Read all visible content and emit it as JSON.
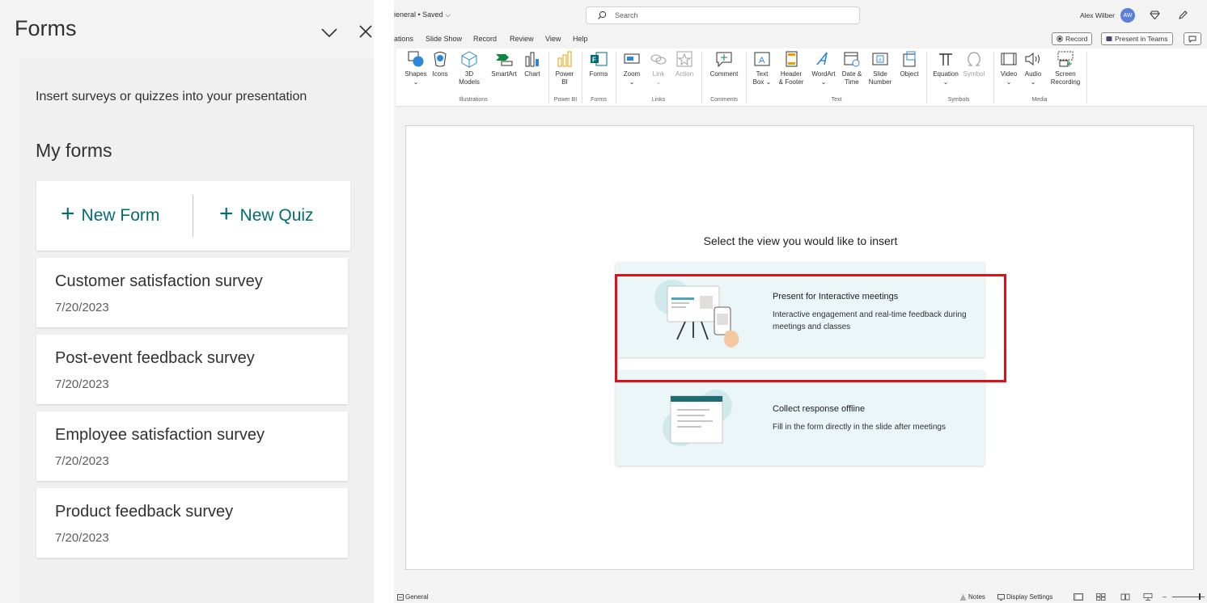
{
  "forms_pane": {
    "title": "Forms",
    "description": "Insert surveys or quizzes into your presentation",
    "section_title": "My forms",
    "new_form_label": "New Form",
    "new_quiz_label": "New Quiz",
    "forms": [
      {
        "name": "Customer satisfaction survey",
        "date": "7/20/2023"
      },
      {
        "name": "Post-event feedback survey",
        "date": "7/20/2023"
      },
      {
        "name": "Employee satisfaction survey",
        "date": "7/20/2023"
      },
      {
        "name": "Product feedback survey",
        "date": "7/20/2023"
      }
    ]
  },
  "titlebar": {
    "doc_title": "ieneral • Saved",
    "search_placeholder": "Search",
    "user_name": "Alex Wilber",
    "user_initials": "AW"
  },
  "tabs": [
    "ations",
    "Slide Show",
    "Record",
    "Review",
    "View",
    "Help"
  ],
  "tab_actions": {
    "record": "Record",
    "present_in_teams": "Present in Teams"
  },
  "ribbon": {
    "buttons": {
      "shapes": "Shapes",
      "icons": "Icons",
      "models_3d_1": "3D",
      "models_3d_2": "Models",
      "smartart": "SmartArt",
      "chart": "Chart",
      "power_bi_1": "Power",
      "power_bi_2": "BI",
      "forms": "Forms",
      "zoom": "Zoom",
      "link": "Link",
      "action": "Action",
      "comment": "Comment",
      "textbox_1": "Text",
      "textbox_2": "Box",
      "header_1": "Header",
      "header_2": "& Footer",
      "wordart": "WordArt",
      "datetime_1": "Date &",
      "datetime_2": "Time",
      "slidenum_1": "Slide",
      "slidenum_2": "Number",
      "object": "Object",
      "equation": "Equation",
      "symbol": "Symbol",
      "video": "Video",
      "audio": "Audio",
      "screenrec_1": "Screen",
      "screenrec_2": "Recording"
    },
    "groups": {
      "illustrations": "Illustrations",
      "power_bi": "Power BI",
      "forms": "Forms",
      "links": "Links",
      "comments": "Comments",
      "text": "Text",
      "symbols": "Symbols",
      "media": "Media"
    }
  },
  "slide": {
    "heading": "Select the view you would like to insert",
    "options": [
      {
        "title": "Present for Interactive meetings",
        "description": "Interactive engagement and real-time feedback during meetings and classes"
      },
      {
        "title": "Collect response offline",
        "description": "Fill in the form directly in the slide after meetings"
      }
    ]
  },
  "statusbar": {
    "sensitivity": "General",
    "notes": "Notes",
    "display_settings": "Display Settings"
  },
  "colors": {
    "forms_accent": "#036c70",
    "highlight": "#e0101b",
    "option_bg": "#eaf6f7"
  }
}
